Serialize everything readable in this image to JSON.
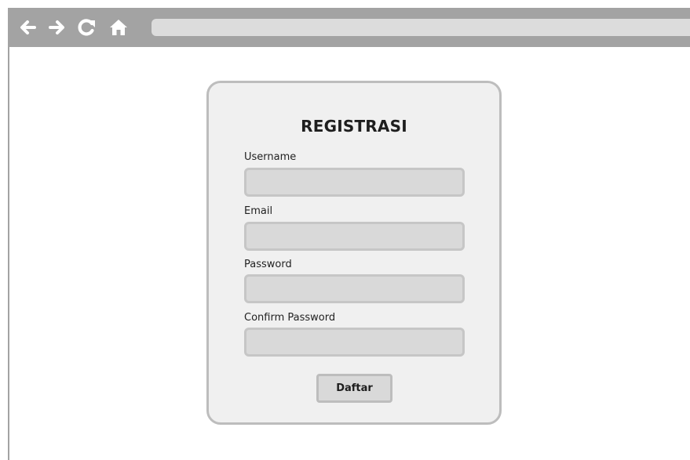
{
  "browser": {
    "nav_icons": [
      "back-arrow-icon",
      "forward-arrow-icon",
      "reload-icon",
      "home-icon"
    ],
    "address_value": "",
    "chrome_color": "#a3a3a3"
  },
  "form": {
    "title": "REGISTRASI",
    "fields": [
      {
        "label": "Username",
        "value": "",
        "type": "text"
      },
      {
        "label": "Email",
        "value": "",
        "type": "email"
      },
      {
        "label": "Password",
        "value": "",
        "type": "password"
      },
      {
        "label": "Confirm Password",
        "value": "",
        "type": "password"
      }
    ],
    "submit_label": "Daftar"
  }
}
